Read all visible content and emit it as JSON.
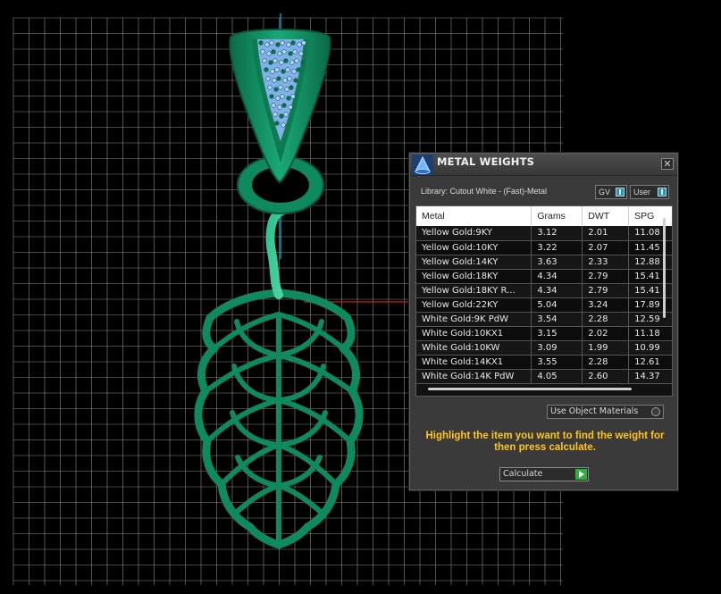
{
  "colors": {
    "background": "#000000",
    "grid": "#8a8a8a",
    "model": "#0f8a5e",
    "model_light": "#3fc79a",
    "gems": "#8fb6ff",
    "axis_x": "#d01818",
    "axis_y": "#00b4d8",
    "panel": "#3a3a3a",
    "instruction": "#ffc51e",
    "calculate_play": "#2bb23a"
  },
  "icons": {
    "app": "matrix-cone-icon",
    "close": "close-icon",
    "toggle": "toggle-icon",
    "radio": "radio-icon",
    "play": "play-icon"
  },
  "panel": {
    "title": "METAL WEIGHTS",
    "close_label": "✕",
    "library": "Library: Cutout White - (Fast)-Metal",
    "gv_label": "GV",
    "user_label": "User",
    "columns": [
      "Metal",
      "Grams",
      "DWT",
      "SPG"
    ],
    "rows": [
      {
        "metal": "Yellow Gold:9KY",
        "grams": "3.12",
        "dwt": "2.01",
        "spg": "11.08"
      },
      {
        "metal": "Yellow Gold:10KY",
        "grams": "3.22",
        "dwt": "2.07",
        "spg": "11.45"
      },
      {
        "metal": "Yellow Gold:14KY",
        "grams": "3.63",
        "dwt": "2.33",
        "spg": "12.88"
      },
      {
        "metal": "Yellow Gold:18KY",
        "grams": "4.34",
        "dwt": "2.79",
        "spg": "15.41"
      },
      {
        "metal": "Yellow Gold:18KY R...",
        "grams": "4.34",
        "dwt": "2.79",
        "spg": "15.41"
      },
      {
        "metal": "Yellow Gold:22KY",
        "grams": "5.04",
        "dwt": "3.24",
        "spg": "17.89"
      },
      {
        "metal": "White Gold:9K PdW",
        "grams": "3.54",
        "dwt": "2.28",
        "spg": "12.59"
      },
      {
        "metal": "White Gold:10KX1",
        "grams": "3.15",
        "dwt": "2.02",
        "spg": "11.18"
      },
      {
        "metal": "White Gold:10KW",
        "grams": "3.09",
        "dwt": "1.99",
        "spg": "10.99"
      },
      {
        "metal": "White Gold:14KX1",
        "grams": "3.55",
        "dwt": "2.28",
        "spg": "12.61"
      },
      {
        "metal": "White Gold:14K PdW",
        "grams": "4.05",
        "dwt": "2.60",
        "spg": "14.37"
      }
    ],
    "use_object_materials": "Use Object Materials",
    "instruction": "Highlight the item you want to find the weight for then press calculate.",
    "calculate_label": "Calculate"
  }
}
